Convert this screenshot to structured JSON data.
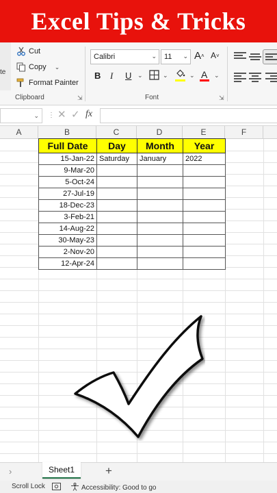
{
  "banner": {
    "title": "Excel Tips & Tricks"
  },
  "ribbon": {
    "paste_label": "te",
    "clipboard": {
      "cut_label": "Cut",
      "copy_label": "Copy",
      "format_painter_label": "Format Painter",
      "group_label": "Clipboard"
    },
    "font": {
      "font_name": "Calibri",
      "font_size": "11",
      "grow_label": "A",
      "shrink_label": "A",
      "bold_label": "B",
      "italic_label": "I",
      "underline_label": "U",
      "font_color_label": "A",
      "group_label": "Font",
      "highlight_color": "#ffff00",
      "font_color": "#ff0000"
    }
  },
  "formula_bar": {
    "fx_label": "fx"
  },
  "columns": [
    "A",
    "B",
    "C",
    "D",
    "E",
    "F"
  ],
  "table": {
    "headers": [
      "Full Date",
      "Day",
      "Month",
      "Year"
    ],
    "rows": [
      [
        "15-Jan-22",
        "Saturday",
        "January",
        "2022"
      ],
      [
        "9-Mar-20",
        "",
        "",
        ""
      ],
      [
        "5-Oct-24",
        "",
        "",
        ""
      ],
      [
        "27-Jul-19",
        "",
        "",
        ""
      ],
      [
        "18-Dec-23",
        "",
        "",
        ""
      ],
      [
        "3-Feb-21",
        "",
        "",
        ""
      ],
      [
        "14-Aug-22",
        "",
        "",
        ""
      ],
      [
        "30-May-23",
        "",
        "",
        ""
      ],
      [
        "2-Nov-20",
        "",
        "",
        ""
      ],
      [
        "12-Apr-24",
        "",
        "",
        ""
      ]
    ],
    "header_fill": "#ffff00"
  },
  "sheets": {
    "active": "Sheet1",
    "add_label": "+"
  },
  "status": {
    "scroll_lock": "Scroll Lock",
    "accessibility": "Accessibility: Good to go"
  },
  "colors": {
    "banner": "#e8120c",
    "sheet_accent": "#1e7145"
  }
}
